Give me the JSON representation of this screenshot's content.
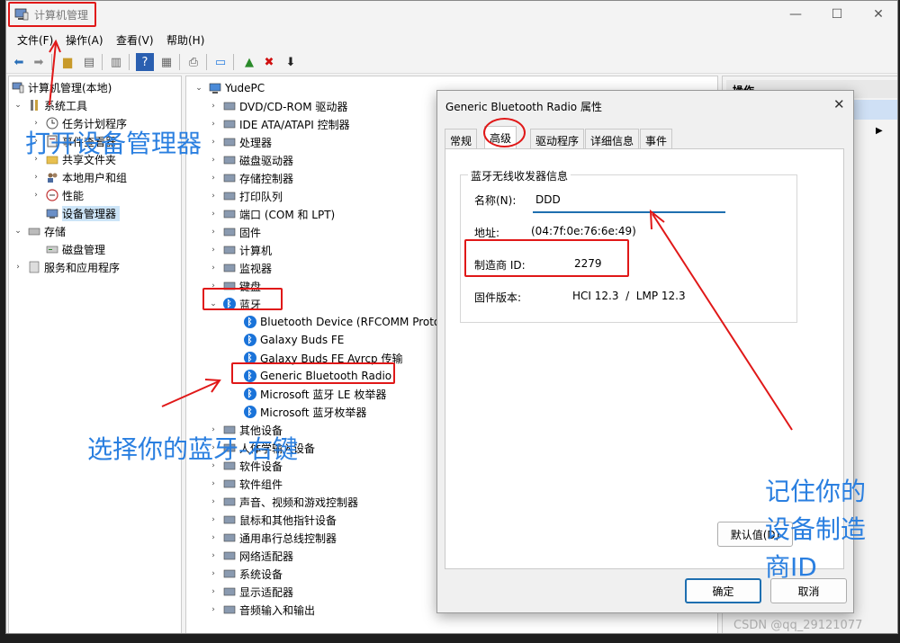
{
  "window": {
    "title": "计算机管理",
    "min": "—",
    "max": "☐",
    "close": "✕"
  },
  "menu": [
    "文件(F)",
    "操作(A)",
    "查看(V)",
    "帮助(H)"
  ],
  "left_tree": [
    {
      "label": "计算机管理(本地)"
    },
    {
      "label": "系统工具"
    },
    {
      "label": "任务计划程序"
    },
    {
      "label": "事件查看器"
    },
    {
      "label": "共享文件夹"
    },
    {
      "label": "本地用户和组"
    },
    {
      "label": "性能"
    },
    {
      "label": "设备管理器"
    },
    {
      "label": "存储"
    },
    {
      "label": "磁盘管理"
    },
    {
      "label": "服务和应用程序"
    }
  ],
  "device_tree": {
    "root": "YudePC",
    "items": [
      "DVD/CD-ROM 驱动器",
      "IDE ATA/ATAPI 控制器",
      "处理器",
      "磁盘驱动器",
      "存储控制器",
      "打印队列",
      "端口 (COM 和 LPT)",
      "固件",
      "计算机",
      "监视器",
      "键盘",
      "蓝牙",
      "Bluetooth Device (RFCOMM Protocol TDI)",
      "Galaxy Buds FE",
      "Galaxy Buds FE Avrcp 传输",
      "Generic Bluetooth Radio",
      "Microsoft 蓝牙 LE 枚举器",
      "Microsoft 蓝牙枚举器",
      "其他设备",
      "人体学输入设备",
      "软件设备",
      "软件组件",
      "声音、视频和游戏控制器",
      "鼠标和其他指针设备",
      "通用串行总线控制器",
      "网络适配器",
      "系统设备",
      "显示适配器",
      "音频输入和输出"
    ]
  },
  "actions_panel": {
    "header": "操作",
    "arrow": "▶"
  },
  "dialog": {
    "title": "Generic Bluetooth Radio 属性",
    "close": "✕",
    "tabs": [
      "常规",
      "高级",
      "驱动程序",
      "详细信息",
      "事件"
    ],
    "group_title": "蓝牙无线收发器信息",
    "name_label": "名称(N):",
    "name_value": "DDD",
    "address_label": "地址:",
    "address_value": "(04:7f:0e:76:6e:49)",
    "manufacturer_label": "制造商 ID:",
    "manufacturer_value": "2279",
    "firmware_label": "固件版本:",
    "firmware_value": "HCI 12.3  /  LMP 12.3",
    "default_button": "默认值(D)",
    "ok_button": "确定",
    "cancel_button": "取消"
  },
  "annotations": {
    "open_device_manager": "打开设备管理器",
    "select_bluetooth": "选择你的蓝牙-右键",
    "remember_line1": "记住你的",
    "remember_line2": "设备制造",
    "remember_line3": "商ID"
  },
  "watermark": "CSDN @qq_29121077",
  "colors": {
    "annotation_blue": "#2a7fe0",
    "highlight_red": "#e01818",
    "bluetooth_blue": "#1a73d9"
  }
}
